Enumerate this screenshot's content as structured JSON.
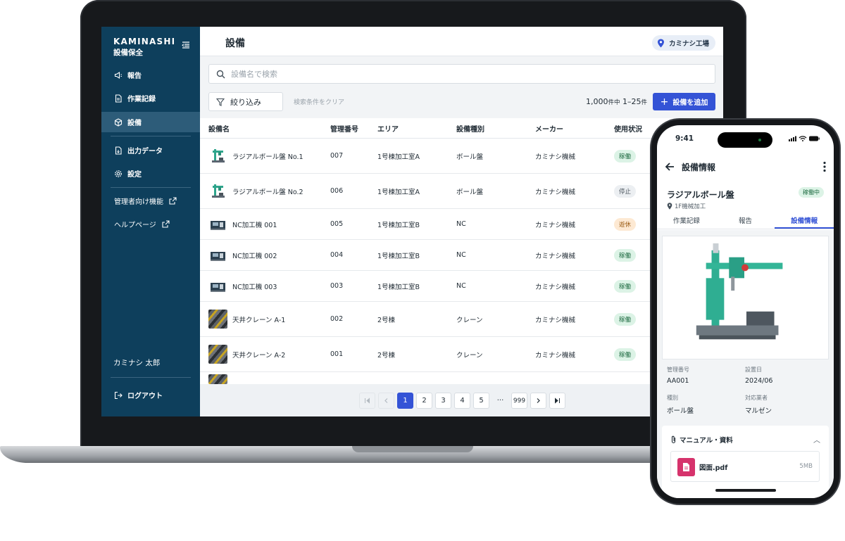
{
  "sidebar": {
    "brand": "KAMINASHI",
    "brand_sub": "設備保全",
    "items": [
      {
        "label": "報告"
      },
      {
        "label": "作業記録"
      },
      {
        "label": "設備"
      },
      {
        "label": "出力データ"
      },
      {
        "label": "設定"
      }
    ],
    "external": [
      {
        "label": "管理者向け機能"
      },
      {
        "label": "ヘルプページ"
      }
    ],
    "user_name": "カミナシ 太郎",
    "logout": "ログアウト"
  },
  "header": {
    "title": "設備",
    "factory": "カミナシ工場"
  },
  "search": {
    "placeholder": "設備名で検索"
  },
  "toolbar": {
    "filter_label": "絞り込み",
    "clear_label": "検索条件をクリア",
    "count_total": "1,000",
    "count_total_unit": "件中",
    "count_range": "1–25",
    "count_range_unit": "件",
    "add_label": "設備を追加"
  },
  "table": {
    "columns": [
      "設備名",
      "管理番号",
      "エリア",
      "設備種別",
      "メーカー",
      "使用状況"
    ],
    "rows": [
      {
        "name": "ラジアルボール盤 No.1",
        "number": "007",
        "area": "1号棟加工室A",
        "type": "ボール盤",
        "maker": "カミナシ機械",
        "status": "稼働"
      },
      {
        "name": "ラジアルボール盤 No.2",
        "number": "006",
        "area": "1号棟加工室A",
        "type": "ボール盤",
        "maker": "カミナシ機械",
        "status": "停止"
      },
      {
        "name": "NC加工機 001",
        "number": "005",
        "area": "1号棟加工室B",
        "type": "NC",
        "maker": "カミナシ機械",
        "status": "遊休"
      },
      {
        "name": "NC加工機 002",
        "number": "004",
        "area": "1号棟加工室B",
        "type": "NC",
        "maker": "カミナシ機械",
        "status": "稼働"
      },
      {
        "name": "NC加工機 003",
        "number": "003",
        "area": "1号棟加工室B",
        "type": "NC",
        "maker": "カミナシ機械",
        "status": "稼働"
      },
      {
        "name": "天井クレーン A-1",
        "number": "002",
        "area": "2号棟",
        "type": "クレーン",
        "maker": "カミナシ機械",
        "status": "稼働"
      },
      {
        "name": "天井クレーン A-2",
        "number": "001",
        "area": "2号棟",
        "type": "クレーン",
        "maker": "カミナシ機械",
        "status": "稼働"
      }
    ]
  },
  "pagination": {
    "pages": [
      "1",
      "2",
      "3",
      "4",
      "5"
    ],
    "ellipsis": "···",
    "last": "999",
    "current": "1"
  },
  "mobile": {
    "time": "9:41",
    "title": "設備情報",
    "equipment_name": "ラジアルボール盤",
    "location": "1F機械加工",
    "status": "稼働中",
    "tabs": [
      "作業記録",
      "報告",
      "設備情報"
    ],
    "active_tab": "設備情報",
    "info": [
      {
        "label": "管理番号",
        "value": "AA001"
      },
      {
        "label": "設置日",
        "value": "2024/06"
      },
      {
        "label": "種別",
        "value": "ボール盤"
      },
      {
        "label": "対応業者",
        "value": "マルゼン"
      }
    ],
    "manual_title": "マニュアル・資料",
    "file_name": "図面.pdf",
    "file_size": "5MB"
  },
  "colors": {
    "sidebar": "#0e3f5c",
    "primary": "#3453d6",
    "status_running": "#dcf3e6",
    "status_stopped": "#eceff2",
    "status_idle": "#fde9d3"
  }
}
